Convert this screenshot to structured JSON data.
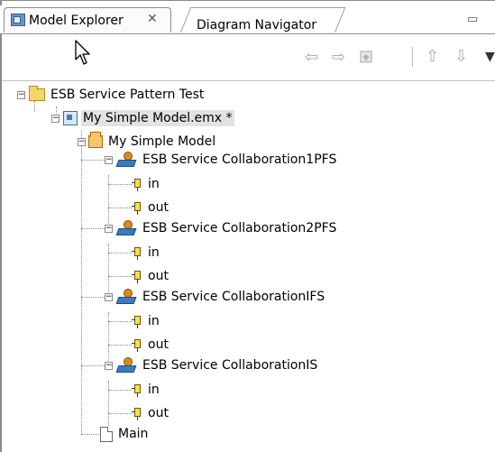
{
  "tabs": {
    "active_label": "Model Explorer",
    "close_glyph": "✕",
    "inactive_label": "Diagram Navigator"
  },
  "window": {
    "minimize_glyph": "▭"
  },
  "toolbar": {
    "back_icon": "arrow-left-icon",
    "forward_icon": "arrow-right-icon",
    "home_icon": "home-icon",
    "up_icon": "arrow-up-icon",
    "down_icon": "arrow-down-icon",
    "menu_icon": "view-menu-icon"
  },
  "tree": {
    "project": {
      "label": "ESB Service Pattern Test",
      "expanded": true
    },
    "model_file": {
      "label": "My Simple Model.emx *",
      "selected": true,
      "expanded": true
    },
    "model": {
      "label": "My Simple Model",
      "expanded": true
    },
    "collaborations": [
      {
        "label": "ESB Service Collaboration1PFS",
        "ports": [
          "in",
          "out"
        ]
      },
      {
        "label": "ESB Service Collaboration2PFS",
        "ports": [
          "in",
          "out"
        ]
      },
      {
        "label": "ESB Service CollaborationIFS",
        "ports": [
          "in",
          "out"
        ]
      },
      {
        "label": "ESB Service CollaborationIS",
        "ports": [
          "in",
          "out"
        ]
      }
    ],
    "diagram": {
      "label": "Main"
    }
  }
}
